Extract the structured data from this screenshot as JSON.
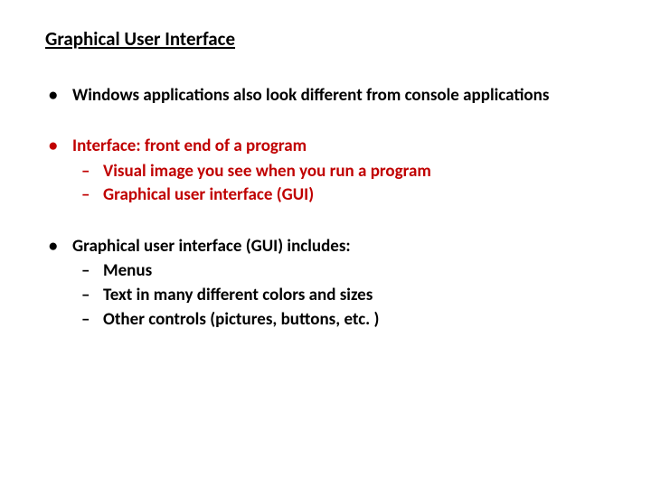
{
  "title": "Graphical User Interface",
  "bullets": {
    "b1": "Windows applications also look different from console applications",
    "b2": {
      "text": "Interface: front end of a program",
      "sub": {
        "s1": "Visual image you see when you run a program",
        "s2": "Graphical user interface (GUI)"
      }
    },
    "b3": {
      "text": "Graphical user interface (GUI) includes:",
      "sub": {
        "s1": "Menus",
        "s2": "Text in many different colors and sizes",
        "s3": "Other controls (pictures, buttons, etc. )"
      }
    }
  }
}
